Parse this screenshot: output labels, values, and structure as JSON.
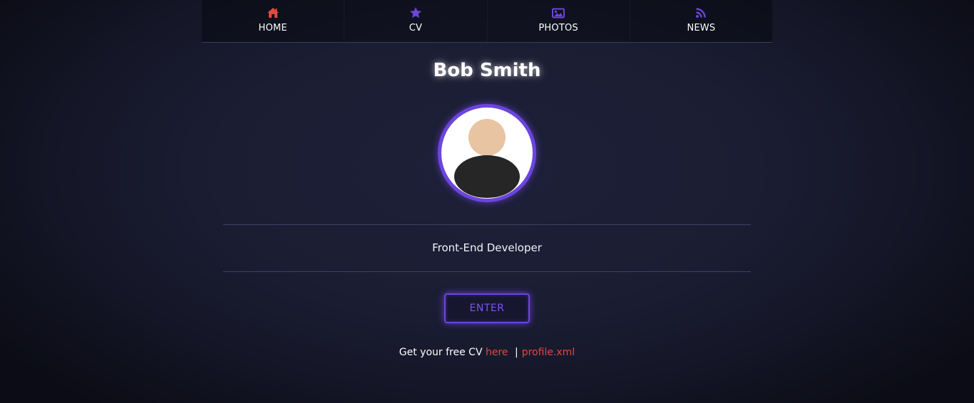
{
  "nav": {
    "items": [
      {
        "label": "HOME",
        "icon": "home-icon",
        "color": "#e04a3e"
      },
      {
        "label": "CV",
        "icon": "star-icon",
        "color": "#6c45dd"
      },
      {
        "label": "PHOTOS",
        "icon": "image-icon",
        "color": "#6c45dd"
      },
      {
        "label": "NEWS",
        "icon": "rss-icon",
        "color": "#6c45dd"
      }
    ]
  },
  "profile": {
    "name": "Bob Smith",
    "role": "Front-End Developer",
    "avatar_icon": "user-avatar-icon"
  },
  "enter_button": {
    "label": "ENTER"
  },
  "cv_line": {
    "prefix": "Get your free CV",
    "link_here": "here",
    "separator": "|",
    "link_profile": "profile.xml"
  },
  "colors": {
    "accent": "#6c45dd",
    "link": "#e04a3e",
    "background": "#1b1d33"
  }
}
